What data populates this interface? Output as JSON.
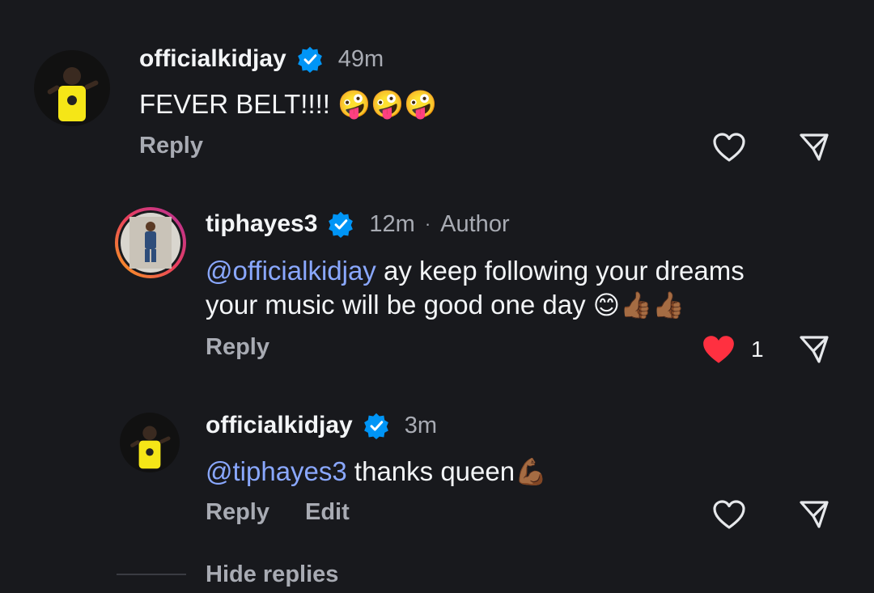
{
  "colors": {
    "background": "#18191d",
    "verified_badge": "#0095f6",
    "mention": "#8aa8ff",
    "liked_heart": "#ff3040",
    "secondary_text": "#a8abb3"
  },
  "comments": [
    {
      "username": "officialkidjay",
      "time": "49m",
      "text": "FEVER BELT!!!! 🤪🤪🤪",
      "reply_label": "Reply",
      "like_icon": "heart-outline-icon",
      "share_icon": "share-icon"
    },
    {
      "username": "tiphayes3",
      "time": "12m",
      "separator": "·",
      "author_label": "Author",
      "mention": "@officialkidjay",
      "text_line1": " ay keep following your dreams",
      "text_line2": "your music will be good one day ",
      "emojis": "😊👍🏾👍🏾",
      "reply_label": "Reply",
      "like_count": "1",
      "like_icon": "heart-filled-icon",
      "share_icon": "share-icon"
    },
    {
      "username": "officialkidjay",
      "time": "3m",
      "mention": "@tiphayes3",
      "text": " thanks queen",
      "emoji": "💪🏾",
      "reply_label": "Reply",
      "edit_label": "Edit",
      "like_icon": "heart-outline-icon",
      "share_icon": "share-icon"
    }
  ],
  "hide_replies_label": "Hide replies"
}
